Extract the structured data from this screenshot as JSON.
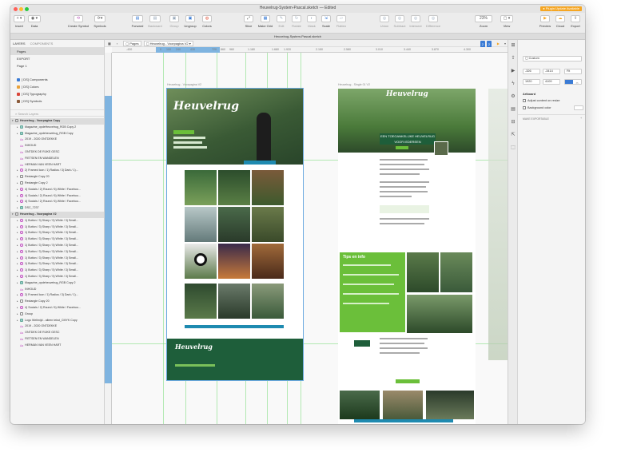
{
  "window": {
    "title": "Heuvelrug-System-Pascal.sketch — Edited",
    "plugin_update": "● Plugin Update Available",
    "doc_tab": "Heuvelrug-System-Pascal.sketch"
  },
  "toolbar": {
    "insert": "Insert",
    "data": "Data",
    "create_symbol": "Create Symbol",
    "symbols": "Symbols",
    "forward": "Forward",
    "backward": "Backward",
    "group": "Group",
    "ungroup": "Ungroup",
    "colors": "Colors",
    "slice": "Slice",
    "make_grid": "Make Grid",
    "edit": "Edit",
    "rotate": "Rotate",
    "mask": "Mask",
    "scale": "Scale",
    "flatten": "Flatten",
    "union": "Union",
    "subtract": "Subtract",
    "intersect": "Intersect",
    "difference": "Difference",
    "zoom": "Zoom",
    "zoom_value": "23%",
    "view": "View",
    "preview": "Preview",
    "cloud": "Cloud",
    "export": "Export"
  },
  "left_panel": {
    "tab_layers": "LAYERS",
    "tab_components": "COMPONENTS",
    "pages_label": "Pages",
    "pages": [
      "EXPORT",
      "Page 1"
    ],
    "symbol_pages": [
      {
        "label": "[ DS] Components",
        "color": "#3a7bd5"
      },
      {
        "label": "[ DS] Colors",
        "color": "#e8a13a"
      },
      {
        "label": "[ DS] Typography",
        "color": "#d9463a"
      },
      {
        "label": "[ DS] Symbols",
        "color": "#8a5a3a"
      }
    ],
    "search_placeholder": "Search Layers",
    "layers": [
      {
        "label": "Heuvelrug - Voorpagina Copy",
        "kind": "artboard",
        "indent": 0
      },
      {
        "label": "Magazine_opdeHeuvelrug_RGB Copy 2",
        "kind": "img",
        "indent": 1
      },
      {
        "label": "Magazine_opdeheuvelrug_RGB Copy",
        "kind": "img",
        "indent": 1
      },
      {
        "label": "2019 - 2020 ONTDEKKE",
        "kind": "txt",
        "indent": 1
      },
      {
        "label": "INHOUD",
        "kind": "txt",
        "indent": 1
      },
      {
        "label": "ONTDEK DE RIJKE GESC",
        "kind": "txt",
        "indent": 1
      },
      {
        "label": "FIETSEN EN WANDELEN",
        "kind": "txt",
        "indent": 1
      },
      {
        "label": "HERMAN VAN VEEN HART",
        "kind": "txt",
        "indent": 1
      },
      {
        "label": "2) Framed Icon / 1) Radius / 3) Dark / 1)...",
        "kind": "sym",
        "indent": 1
      },
      {
        "label": "Rectangle Copy 20",
        "kind": "rect",
        "indent": 1
      },
      {
        "label": "Rectangle Copy 2",
        "kind": "rect",
        "indent": 1
      },
      {
        "label": "4) Socials / 2) Round / 6) White / Faceboo...",
        "kind": "sym",
        "indent": 1
      },
      {
        "label": "4) Socials / 2) Round / 6) White / Faceboo...",
        "kind": "sym",
        "indent": 1
      },
      {
        "label": "4) Socials / 2) Round / 6) White / Faceboo...",
        "kind": "sym",
        "indent": 1
      },
      {
        "label": "DSC_7237",
        "kind": "img",
        "indent": 1
      },
      {
        "label": "Heuvelrug - Voorpagina V2",
        "kind": "artboard",
        "indent": 0
      },
      {
        "label": "1) Button / 3) Sharp / 5) White / 3) Small...",
        "kind": "sym",
        "indent": 1
      },
      {
        "label": "1) Button / 3) Sharp / 5) White / 3) Small...",
        "kind": "sym",
        "indent": 1
      },
      {
        "label": "1) Button / 3) Sharp / 5) White / 3) Small...",
        "kind": "sym",
        "indent": 1
      },
      {
        "label": "1) Button / 3) Sharp / 5) White / 3) Small...",
        "kind": "sym",
        "indent": 1
      },
      {
        "label": "1) Button / 3) Sharp / 5) White / 3) Small...",
        "kind": "sym",
        "indent": 1
      },
      {
        "label": "1) Button / 3) Sharp / 5) White / 3) Small...",
        "kind": "sym",
        "indent": 1
      },
      {
        "label": "1) Button / 3) Sharp / 5) White / 3) Small...",
        "kind": "sym",
        "indent": 1
      },
      {
        "label": "1) Button / 3) Sharp / 5) White / 3) Small...",
        "kind": "sym",
        "indent": 1
      },
      {
        "label": "1) Button / 3) Sharp / 5) White / 3) Small...",
        "kind": "sym",
        "indent": 1
      },
      {
        "label": "1) Button / 3) Sharp / 5) White / 3) Small...",
        "kind": "sym",
        "indent": 1
      },
      {
        "label": "Magazine_opdeheuvelrug_RGB Copy 2",
        "kind": "img",
        "indent": 1
      },
      {
        "label": "INHOUD",
        "kind": "txt",
        "indent": 1
      },
      {
        "label": "2) Framed Icon / 1) Radius / 3) Dark / 1)...",
        "kind": "sym",
        "indent": 1
      },
      {
        "label": "Rectangle Copy 20",
        "kind": "rect",
        "indent": 1
      },
      {
        "label": "4) Socials / 2) Round / 6) White / Faceboo...",
        "kind": "sym",
        "indent": 1
      },
      {
        "label": "Group",
        "kind": "rect",
        "indent": 1
      },
      {
        "label": "Logo Wellmijd - alleen tekst_CMYK Copy",
        "kind": "img",
        "indent": 1
      },
      {
        "label": "2019 - 2020 ONTDEKKE",
        "kind": "txt",
        "indent": 1
      },
      {
        "label": "ONTDEK DE RIJKE GESC",
        "kind": "txt",
        "indent": 1
      },
      {
        "label": "FIETSEN EN WANDELEN",
        "kind": "txt",
        "indent": 1
      },
      {
        "label": "HERMAN VAN VEEN HART",
        "kind": "txt",
        "indent": 1
      }
    ]
  },
  "canvas": {
    "breadcrumb_pages": "Pages",
    "breadcrumb_artboard": "Heuvelrug - Voorpagina V2",
    "ruler_ticks": [
      "-430",
      "0",
      "100",
      "240",
      "430",
      "720",
      "860",
      "960",
      "1.180",
      "1.680",
      "1.920",
      "2.150",
      "2.580",
      "3.010",
      "3.440",
      "3.870",
      "4.300"
    ],
    "artboard1_title": "Heuvelrug - Voorpagina V2",
    "artboard2_title": "Heuvelrug - Single 01 V2",
    "hero_title_1": "Heuvelrug",
    "hero_title_2": "Heuvelrug",
    "single_banner": "EEN TOEGANKELIJKE HEUVELRUG VOOR IEDEREEN",
    "green_block_title": "Tips en info"
  },
  "inspector": {
    "preset": "Custom",
    "x": "-326",
    "y": "-3414",
    "fit": "Fit",
    "w": "1920",
    "h": "4109",
    "artboard_label": "Artboard",
    "adjust_label": "Adjust content on resize",
    "bg_label": "Background color",
    "exportable": "MAKE EXPORTABLE"
  },
  "colors": {
    "site_green": "#1e5e3a",
    "accent_green": "#6bbf3a",
    "guide_blue": "#7fb4e0",
    "orange": "#f5a623"
  }
}
